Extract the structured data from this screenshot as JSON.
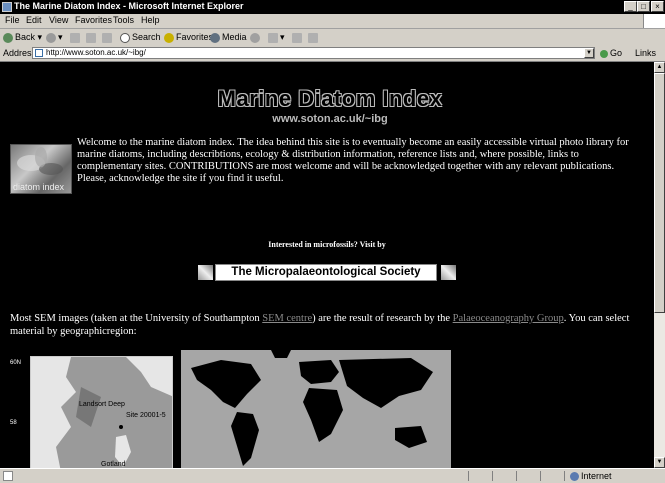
{
  "window": {
    "title": "The Marine Diatom Index - Microsoft Internet Explorer"
  },
  "menu": [
    "File",
    "Edit",
    "View",
    "Favorites",
    "Tools",
    "Help"
  ],
  "toolbar": {
    "back": "Back",
    "search": "Search",
    "favorites": "Favorites",
    "media": "Media"
  },
  "address": {
    "label": "Address",
    "url": "http://www.soton.ac.uk/~ibg/",
    "go": "Go",
    "links": "Links"
  },
  "page": {
    "site_title": "Marine Diatom Index",
    "site_url": "www.soton.ac.uk/~ibg",
    "logo_text": "diatom index",
    "welcome": "Welcome to the marine diatom index. The idea behind this site is to eventually become an easily accessible virtual photo library for marine diatoms, including describtions, ecology & distribution information, reference lists and, where possible, links to complementary sites.  CONTRIBUTIONS are most welcome and will be acknowledged together with any relevant publications. Please, acknowledge the site if you find it useful.",
    "interest": "Interested in microfossils? Visit by",
    "micro_society": "The Micropalaeontological Society",
    "sem": {
      "part1": "Most SEM  images (taken at the University of Southampton ",
      "link1": "SEM centre",
      "part2": ") are the result of research by the ",
      "link2": "Palaeoceanography Group",
      "part3": ". You can select material by geographicregion:"
    },
    "map1": {
      "lat_top": "60N",
      "lat_mid": "58",
      "label_deep": "Landsort Deep",
      "label_site": "Site 20001-5",
      "label_gotland": "Gotland"
    }
  },
  "status": {
    "zone": "Internet"
  }
}
